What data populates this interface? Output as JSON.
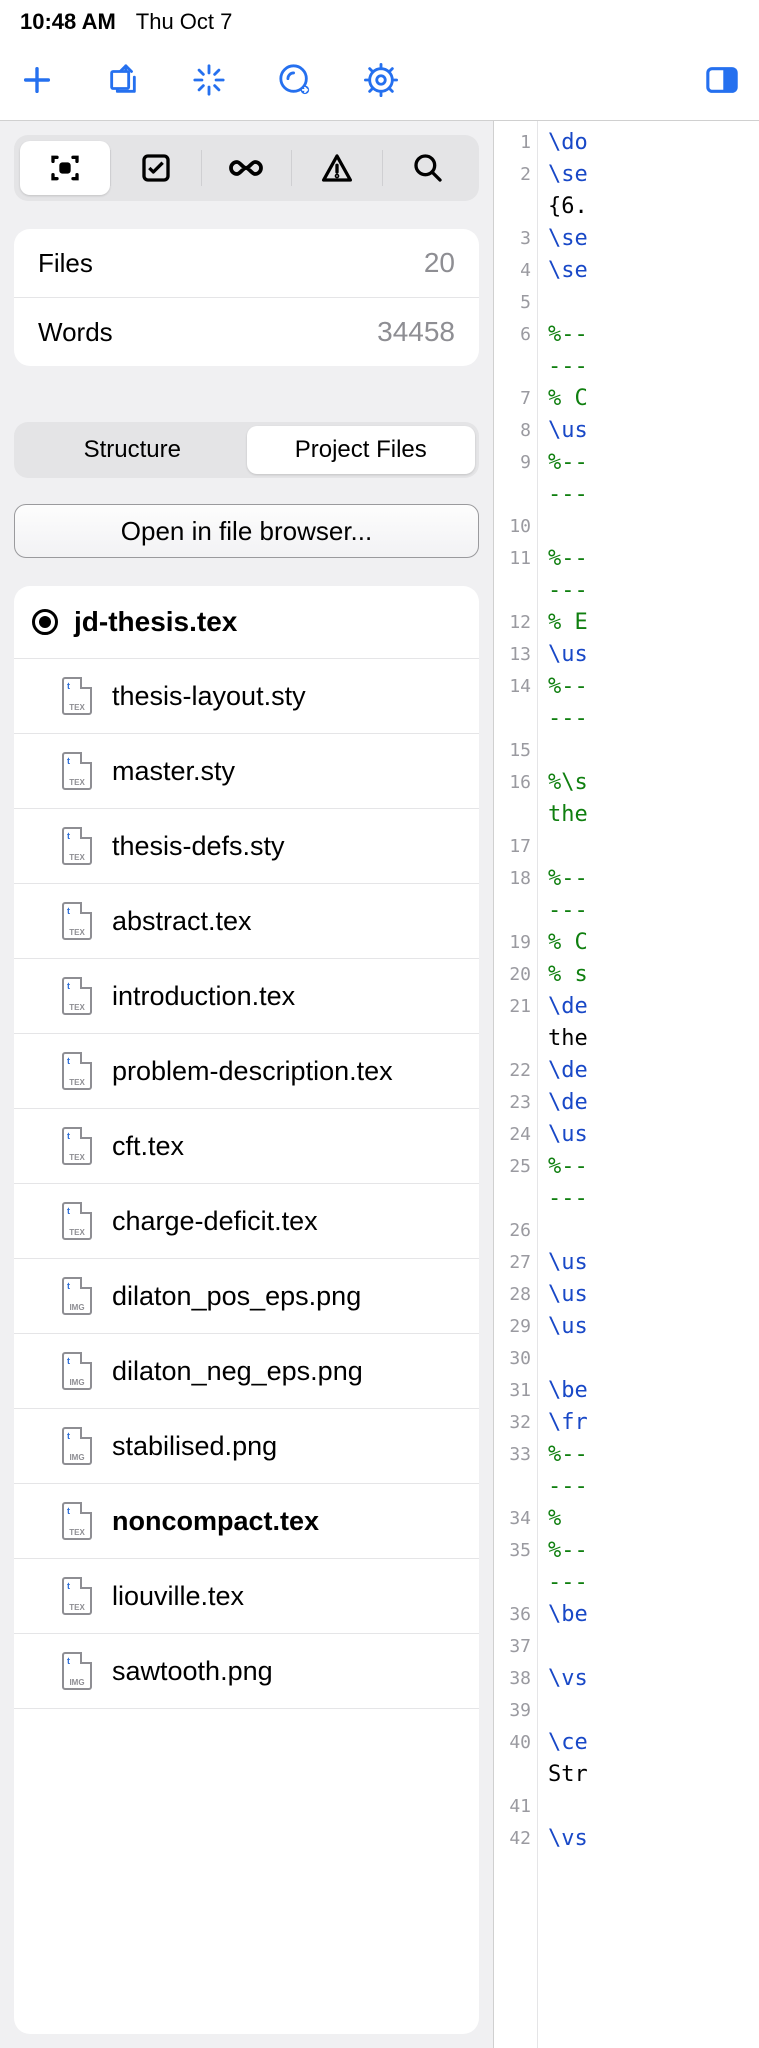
{
  "status": {
    "time": "10:48 AM",
    "date": "Thu Oct 7"
  },
  "stats": {
    "files_label": "Files",
    "files_val": "20",
    "words_label": "Words",
    "words_val": "34458"
  },
  "seg": {
    "a": "Structure",
    "b": "Project Files"
  },
  "open_btn": "Open in file browser...",
  "root_file": "jd-thesis.tex",
  "files": [
    {
      "name": "thesis-layout.sty",
      "ext": "TEX",
      "bold": false
    },
    {
      "name": "master.sty",
      "ext": "TEX",
      "bold": false
    },
    {
      "name": "thesis-defs.sty",
      "ext": "TEX",
      "bold": false
    },
    {
      "name": "abstract.tex",
      "ext": "TEX",
      "bold": false
    },
    {
      "name": "introduction.tex",
      "ext": "TEX",
      "bold": false
    },
    {
      "name": "problem-description.tex",
      "ext": "TEX",
      "bold": false
    },
    {
      "name": "cft.tex",
      "ext": "TEX",
      "bold": false
    },
    {
      "name": "charge-deficit.tex",
      "ext": "TEX",
      "bold": false
    },
    {
      "name": "dilaton_pos_eps.png",
      "ext": "IMG",
      "bold": false
    },
    {
      "name": "dilaton_neg_eps.png",
      "ext": "IMG",
      "bold": false
    },
    {
      "name": "stabilised.png",
      "ext": "IMG",
      "bold": false
    },
    {
      "name": "noncompact.tex",
      "ext": "TEX",
      "bold": true
    },
    {
      "name": "liouville.tex",
      "ext": "TEX",
      "bold": false
    },
    {
      "name": "sawtooth.png",
      "ext": "IMG",
      "bold": false
    }
  ],
  "code_lines": [
    {
      "n": "1",
      "frags": [
        [
          "cmd",
          "\\do"
        ]
      ]
    },
    {
      "n": "2",
      "frags": [
        [
          "cmd",
          "\\se"
        ]
      ]
    },
    {
      "n": "",
      "frags": [
        [
          "txt",
          "{6."
        ]
      ]
    },
    {
      "n": "3",
      "frags": [
        [
          "cmd",
          "\\se"
        ]
      ]
    },
    {
      "n": "4",
      "frags": [
        [
          "cmd",
          "\\se"
        ]
      ]
    },
    {
      "n": "5",
      "frags": []
    },
    {
      "n": "6",
      "frags": [
        [
          "com",
          "%--"
        ]
      ]
    },
    {
      "n": "",
      "frags": [
        [
          "com",
          "---"
        ]
      ]
    },
    {
      "n": "7",
      "frags": [
        [
          "com",
          "% C"
        ]
      ]
    },
    {
      "n": "8",
      "frags": [
        [
          "cmd",
          "\\us"
        ]
      ]
    },
    {
      "n": "9",
      "frags": [
        [
          "com",
          "%--"
        ]
      ]
    },
    {
      "n": "",
      "frags": [
        [
          "com",
          "---"
        ]
      ]
    },
    {
      "n": "10",
      "frags": []
    },
    {
      "n": "11",
      "frags": [
        [
          "com",
          "%--"
        ]
      ]
    },
    {
      "n": "",
      "frags": [
        [
          "com",
          "---"
        ]
      ]
    },
    {
      "n": "12",
      "frags": [
        [
          "com",
          "% E"
        ]
      ]
    },
    {
      "n": "13",
      "frags": [
        [
          "cmd",
          "\\us"
        ]
      ]
    },
    {
      "n": "14",
      "frags": [
        [
          "com",
          "%--"
        ]
      ]
    },
    {
      "n": "",
      "frags": [
        [
          "com",
          "---"
        ]
      ]
    },
    {
      "n": "15",
      "frags": []
    },
    {
      "n": "16",
      "frags": [
        [
          "com",
          "%\\s"
        ]
      ]
    },
    {
      "n": "",
      "frags": [
        [
          "com",
          "the"
        ]
      ]
    },
    {
      "n": "17",
      "frags": []
    },
    {
      "n": "18",
      "frags": [
        [
          "com",
          "%--"
        ]
      ]
    },
    {
      "n": "",
      "frags": [
        [
          "com",
          "---"
        ]
      ]
    },
    {
      "n": "19",
      "frags": [
        [
          "com",
          "% C"
        ]
      ]
    },
    {
      "n": "20",
      "frags": [
        [
          "com",
          "% s"
        ]
      ]
    },
    {
      "n": "21",
      "frags": [
        [
          "cmd",
          "\\de"
        ]
      ]
    },
    {
      "n": "",
      "frags": [
        [
          "txt",
          "the"
        ]
      ]
    },
    {
      "n": "22",
      "frags": [
        [
          "cmd",
          "\\de"
        ]
      ]
    },
    {
      "n": "23",
      "frags": [
        [
          "cmd",
          "\\de"
        ]
      ]
    },
    {
      "n": "24",
      "frags": [
        [
          "cmd",
          "\\us"
        ]
      ]
    },
    {
      "n": "25",
      "frags": [
        [
          "com",
          "%--"
        ]
      ]
    },
    {
      "n": "",
      "frags": [
        [
          "com",
          "---"
        ]
      ]
    },
    {
      "n": "26",
      "frags": []
    },
    {
      "n": "27",
      "frags": [
        [
          "cmd",
          "\\us"
        ]
      ]
    },
    {
      "n": "28",
      "frags": [
        [
          "cmd",
          "\\us"
        ]
      ]
    },
    {
      "n": "29",
      "frags": [
        [
          "cmd",
          "\\us"
        ]
      ]
    },
    {
      "n": "30",
      "frags": []
    },
    {
      "n": "31",
      "frags": [
        [
          "cmd",
          "\\be"
        ]
      ]
    },
    {
      "n": "32",
      "frags": [
        [
          "cmd",
          "\\fr"
        ]
      ]
    },
    {
      "n": "33",
      "frags": [
        [
          "com",
          "%--"
        ]
      ]
    },
    {
      "n": "",
      "frags": [
        [
          "com",
          "---"
        ]
      ]
    },
    {
      "n": "34",
      "frags": [
        [
          "com",
          "%"
        ]
      ]
    },
    {
      "n": "35",
      "frags": [
        [
          "com",
          "%--"
        ]
      ]
    },
    {
      "n": "",
      "frags": [
        [
          "com",
          "---"
        ]
      ]
    },
    {
      "n": "36",
      "frags": [
        [
          "cmd",
          "\\be"
        ]
      ]
    },
    {
      "n": "37",
      "frags": []
    },
    {
      "n": "38",
      "frags": [
        [
          "cmd",
          "\\vs"
        ]
      ]
    },
    {
      "n": "39",
      "frags": []
    },
    {
      "n": "40",
      "frags": [
        [
          "cmd",
          "\\ce"
        ]
      ]
    },
    {
      "n": "",
      "frags": [
        [
          "txt",
          "Str"
        ]
      ]
    },
    {
      "n": "41",
      "frags": []
    },
    {
      "n": "42",
      "frags": [
        [
          "cmd",
          "\\vs"
        ]
      ]
    }
  ]
}
